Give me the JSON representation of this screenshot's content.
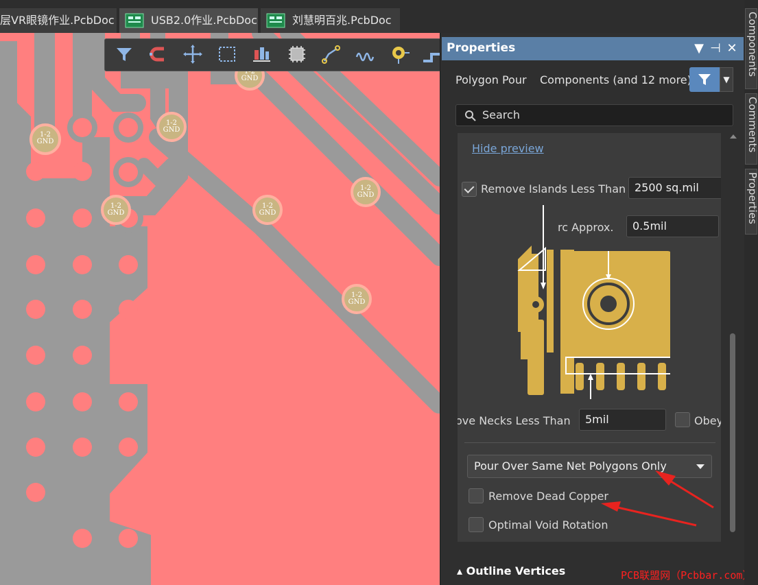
{
  "tabs": [
    {
      "label": "层VR眼镜作业.PcbDoc",
      "active": false,
      "icon": "pcb-doc-icon"
    },
    {
      "label": "USB2.0作业.PcbDoc",
      "active": true,
      "icon": "pcb-doc-icon"
    },
    {
      "label": "刘慧明百兆.PcbDoc",
      "active": false,
      "icon": "pcb-doc-icon"
    }
  ],
  "pcb": {
    "pad_label_net": "1-2",
    "pad_label_name": "GND",
    "colors": {
      "copper": "#ff7f7f",
      "track": "#9a9a9a",
      "pad": "#c9b582"
    }
  },
  "toolbar": {
    "tools": [
      "filter-icon",
      "magnet-icon",
      "move-icon",
      "select-rect-icon",
      "align-icon",
      "component-icon",
      "route-icon",
      "tune-icon",
      "via-icon",
      "dimension-icon"
    ]
  },
  "panel": {
    "title": "Properties",
    "object_type": "Polygon Pour",
    "selection_summary": "Components (and 12 more)",
    "search_placeholder": "Search",
    "hide_preview": "Hide preview",
    "remove_islands_label": "Remove Islands Less Than",
    "remove_islands_checked": true,
    "remove_islands_value": "2500 sq.mil",
    "arc_approx_label": "rc Approx.",
    "arc_approx_value": "0.5mil",
    "remove_necks_label": "ove Necks Less Than",
    "remove_necks_value": "5mil",
    "obey_label": "Obey",
    "obey_checked": false,
    "pour_over_value": "Pour Over Same Net Polygons Only",
    "remove_dead_copper_label": "Remove Dead Copper",
    "remove_dead_copper_checked": false,
    "optimal_void_label": "Optimal Void Rotation",
    "optimal_void_checked": false,
    "outline_vertices": "Outline Vertices",
    "accent_color": "#5a7fa6"
  },
  "side_tabs": [
    "Components",
    "Comments",
    "Properties"
  ],
  "watermark": "PCB联盟网（Pcbbar.com）"
}
